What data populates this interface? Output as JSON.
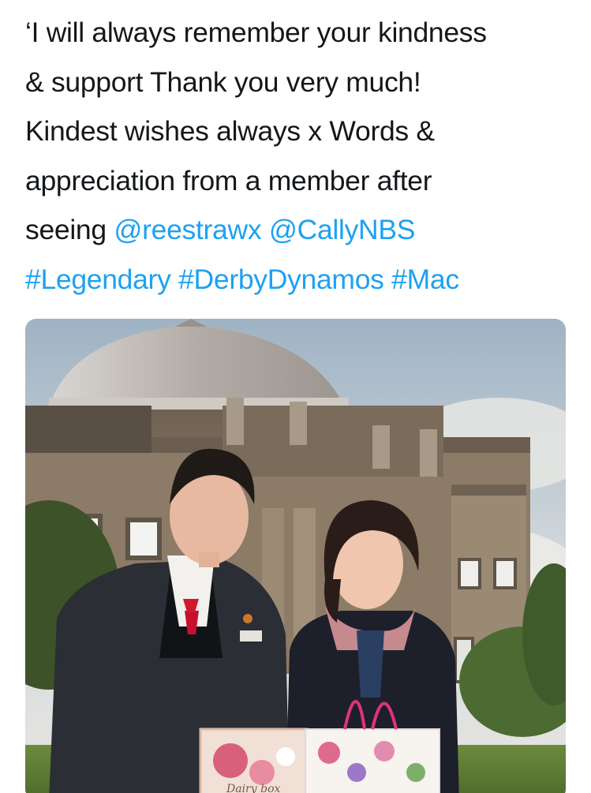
{
  "tweet": {
    "lines": [
      {
        "text": "‘I will always remember your kindness"
      },
      {
        "text": "& support Thank you very much!"
      },
      {
        "text": "Kindest wishes always x Words &"
      },
      {
        "text": "appreciation from a member after"
      }
    ],
    "line5_prefix": "seeing ",
    "mention_1": "@reestrawx",
    "space": " ",
    "mention_2": "@CallyNBS",
    "hashtag_1": "#Legendary",
    "hashtag_2": "#DerbyDynamos",
    "hashtag_3": "#Mac"
  },
  "photo": {
    "box_label": "Dairy box",
    "colors": {
      "link": "#1da1f2",
      "text": "#14171a",
      "sky": "#cfd6dc",
      "stone": "#8a7a66",
      "dome": "#b7b2ab"
    }
  }
}
